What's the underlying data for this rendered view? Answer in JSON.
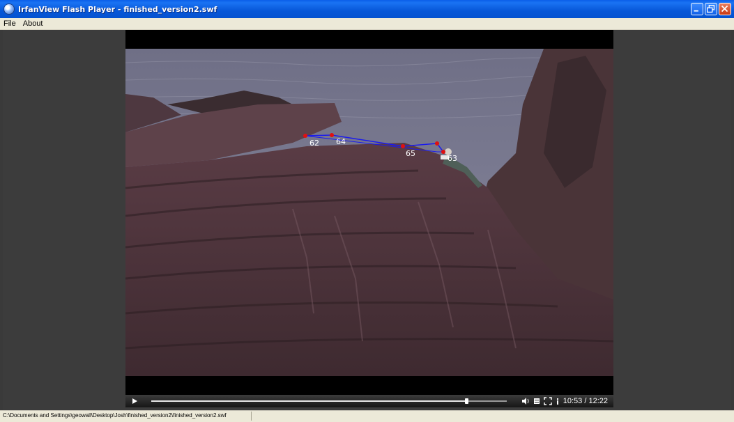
{
  "window": {
    "title": "IrfanView Flash Player - finished_version2.swf",
    "icon": "irfanview-icon",
    "accent_color": "#0a5ee9"
  },
  "menu": {
    "items": [
      {
        "label": "File"
      },
      {
        "label": "About"
      }
    ]
  },
  "video": {
    "points": [
      {
        "label": "62"
      },
      {
        "label": "64"
      },
      {
        "label": "65"
      },
      {
        "label": "63"
      }
    ],
    "marker_color": "#e01010",
    "line_color": "#1a1aee"
  },
  "player": {
    "progress": 0.887,
    "current_time": "10:53",
    "total_time": "12:22",
    "time_display": "10:53 / 12:22",
    "icons": [
      "play-icon",
      "volume-icon",
      "quality-icon",
      "fullscreen-icon",
      "info-icon"
    ]
  },
  "status": {
    "path": "C:\\Documents and Settings\\geowall\\Desktop\\Josh\\finished_version2\\finished_version2.swf"
  }
}
